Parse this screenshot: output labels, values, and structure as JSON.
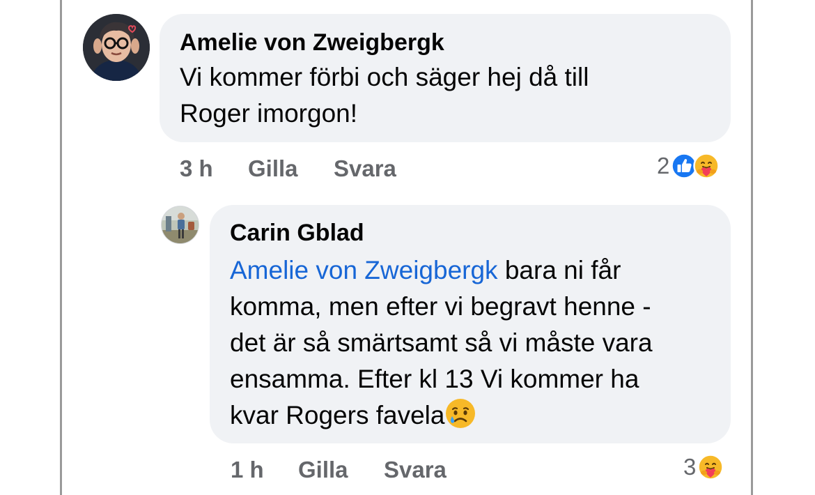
{
  "comments": [
    {
      "author": "Amelie von Zweigbergk",
      "text_lines": [
        "Vi kommer förbi och säger hej då till",
        "Roger imorgon!"
      ],
      "time": "3 h",
      "like_label": "Gilla",
      "reply_label": "Svara",
      "reaction_count": "2",
      "reactions": [
        "like-icon",
        "care-icon"
      ]
    },
    {
      "author": "Carin Gblad",
      "mention": "Amelie von Zweigbergk",
      "text_first_line_rest": " bara ni får",
      "text_lines": [
        "komma, men efter vi begravt henne -",
        "det är så smärtsamt så vi måste vara",
        "ensamma. Efter kl 13 Vi kommer ha",
        "kvar Rogers favela"
      ],
      "trailing_emoji": "sad-tear-face-icon",
      "time": "1 h",
      "like_label": "Gilla",
      "reply_label": "Svara",
      "reaction_count": "3",
      "reactions": [
        "care-icon"
      ]
    }
  ],
  "colors": {
    "bubble": "#f0f2f5",
    "meta_text": "#65676b",
    "mention": "#1766d6",
    "like_blue": "#1877f2",
    "emoji_yellow": "#f7b928",
    "heart_red": "#f33e58"
  }
}
